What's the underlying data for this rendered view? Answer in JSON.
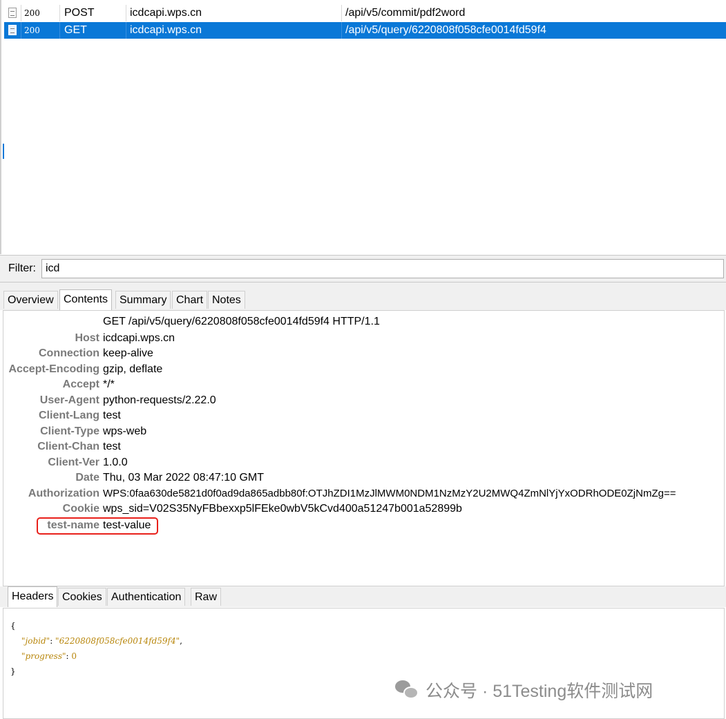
{
  "sessions": {
    "rows": [
      {
        "code": "200",
        "method": "POST",
        "host": "icdcapi.wps.cn",
        "url": "/api/v5/commit/pdf2word",
        "selected": false
      },
      {
        "code": "200",
        "method": "GET",
        "host": "icdcapi.wps.cn",
        "url": "/api/v5/query/6220808f058cfe0014fd59f4",
        "selected": true
      }
    ]
  },
  "filter": {
    "label": "Filter:",
    "value": "icd"
  },
  "top_tabs": [
    {
      "label": "Overview",
      "active": false
    },
    {
      "label": "Contents",
      "active": true
    },
    {
      "label": "Summary",
      "active": false
    },
    {
      "label": "Chart",
      "active": false
    },
    {
      "label": "Notes",
      "active": false
    }
  ],
  "request": {
    "request_line": "GET /api/v5/query/6220808f058cfe0014fd59f4 HTTP/1.1",
    "headers": [
      {
        "name": "Host",
        "value": "icdcapi.wps.cn"
      },
      {
        "name": "Connection",
        "value": "keep-alive"
      },
      {
        "name": "Accept-Encoding",
        "value": "gzip, deflate"
      },
      {
        "name": "Accept",
        "value": "*/*"
      },
      {
        "name": "User-Agent",
        "value": "python-requests/2.22.0"
      },
      {
        "name": "Client-Lang",
        "value": "test"
      },
      {
        "name": "Client-Type",
        "value": "wps-web"
      },
      {
        "name": "Client-Chan",
        "value": "test"
      },
      {
        "name": "Client-Ver",
        "value": "1.0.0"
      },
      {
        "name": "Date",
        "value": "Thu, 03 Mar 2022 08:47:10 GMT"
      },
      {
        "name": "Authorization",
        "value": "WPS:0faa630de5821d0f0ad9da865adbb80f:OTJhZDI1MzJlMWM0NDM1NzMzY2U2MWQ4ZmNlYjYxODRhODE0ZjNmZg=="
      },
      {
        "name": "Cookie",
        "value": "wps_sid=V02S35NyFBbexxp5lFEke0wbV5kCvd400a51247b001a52899b"
      },
      {
        "name": "test-name",
        "value": "test-value"
      }
    ]
  },
  "bottom_tabs": [
    {
      "label": "Headers",
      "active": true
    },
    {
      "label": "Cookies",
      "active": false
    },
    {
      "label": "Authentication",
      "active": false
    },
    {
      "label": "Raw",
      "active": false
    }
  ],
  "response_body": {
    "open_brace": "{",
    "close_brace": "}",
    "lines": [
      {
        "key": "\"jobid\"",
        "sep": ": ",
        "value": "\"6220808f058cfe0014fd59f4\"",
        "tail": ",",
        "value_type": "string"
      },
      {
        "key": "\"progress\"",
        "sep": ": ",
        "value": "0",
        "tail": "",
        "value_type": "number"
      }
    ]
  },
  "watermark": {
    "text": "公众号 · 51Testing软件测试网",
    "icon": "wechat-icon"
  },
  "colors": {
    "selection": "#0a78d7",
    "highlight_box": "#e8201a",
    "json_value": "#b8860b"
  }
}
